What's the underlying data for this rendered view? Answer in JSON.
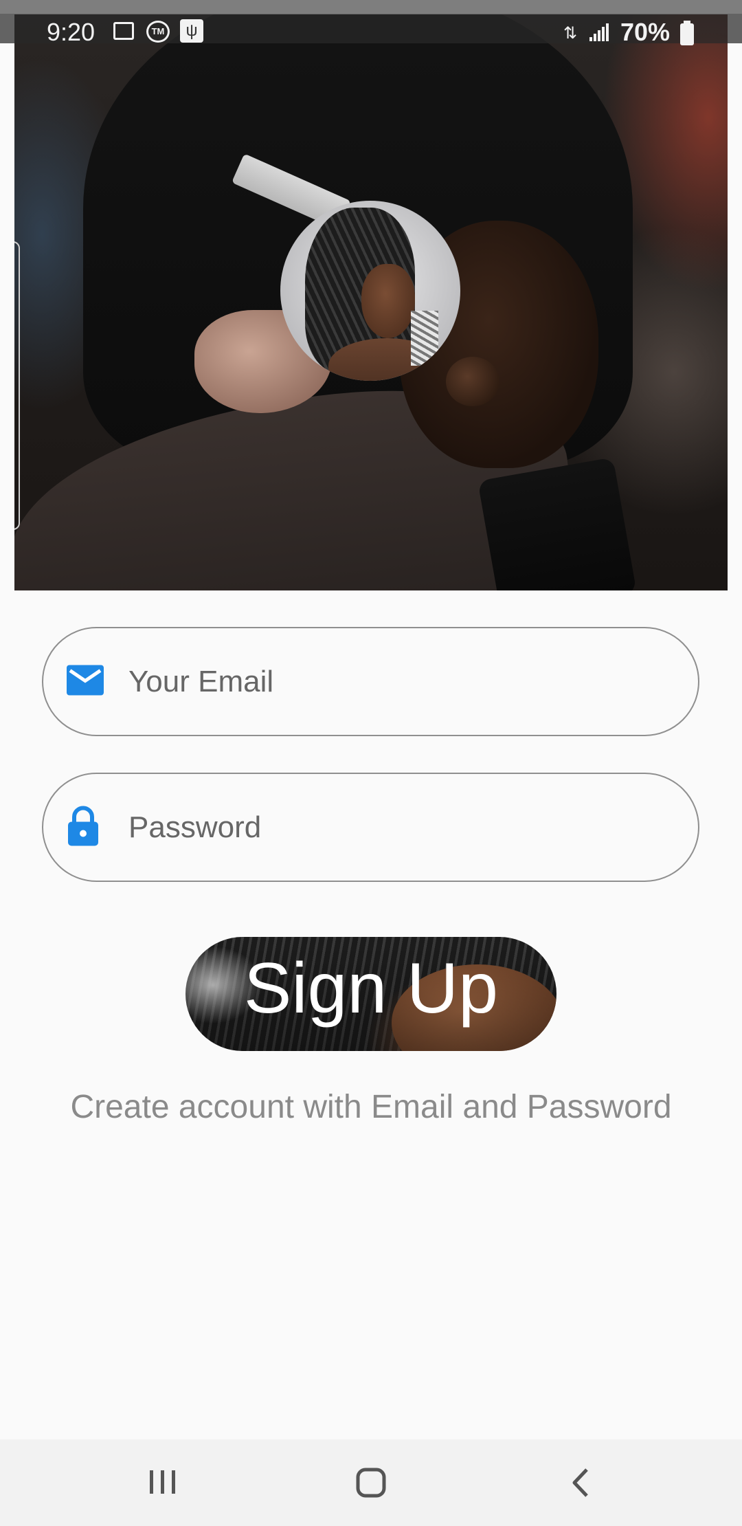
{
  "status_bar": {
    "time": "9:20",
    "battery_pct": "70%",
    "icons": [
      "image-icon",
      "tm-icon",
      "usb-icon",
      "data-transfer-icon",
      "signal-icon",
      "battery-charging-icon"
    ]
  },
  "hero": {
    "description_icon": "barbershop-photo"
  },
  "avatar": {
    "icon": "profile-photo"
  },
  "form": {
    "email": {
      "placeholder": "Your Email",
      "value": "",
      "icon": "mail-icon"
    },
    "password": {
      "placeholder": "Password",
      "value": "",
      "icon": "lock-icon"
    }
  },
  "signup_button": {
    "label": "Sign Up"
  },
  "helper_text": "Create account with Email and Password",
  "nav_bar": {
    "icons": [
      "recent-apps-icon",
      "home-icon",
      "back-icon"
    ]
  },
  "colors": {
    "accent": "#1e88e5",
    "background": "#fafafa",
    "field_border": "#8f8f8f",
    "helper_text": "#8a8a8a"
  }
}
